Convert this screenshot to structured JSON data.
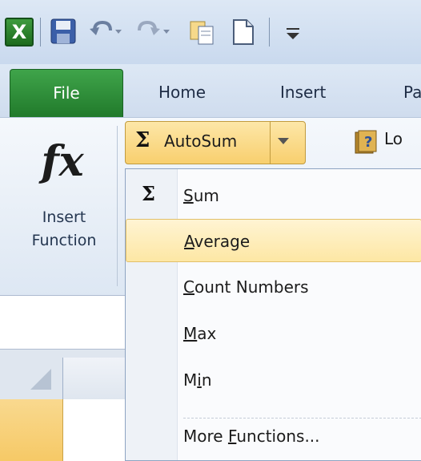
{
  "qat": {
    "app_icon": "excel-icon",
    "app_icon_letter": "X",
    "icons": [
      "save-icon",
      "undo-icon",
      "redo-icon",
      "copy-icon",
      "new-document-icon",
      "customize-qat-icon"
    ]
  },
  "tabs": {
    "file": "File",
    "home": "Home",
    "insert": "Insert",
    "partial": "Pa"
  },
  "ribbon": {
    "insert_function": {
      "glyph": "fx",
      "label": "Insert\nFunction"
    },
    "autosum": {
      "symbol": "Σ",
      "label": "AutoSum"
    },
    "logical": {
      "label": "Lo"
    }
  },
  "menu": {
    "items": [
      {
        "pre": "",
        "access": "S",
        "post": "um",
        "icon": "sigma"
      },
      {
        "pre": "",
        "access": "A",
        "post": "verage",
        "highlighted": true
      },
      {
        "pre": "",
        "access": "C",
        "post": "ount Numbers"
      },
      {
        "pre": "",
        "access": "M",
        "post": "ax"
      },
      {
        "pre": "M",
        "access": "i",
        "post": "n"
      },
      {
        "pre": "More ",
        "access": "F",
        "post": "unctions..."
      }
    ],
    "sigma": "Σ"
  },
  "colors": {
    "file_tab": "#2e8f38",
    "highlight": "#fde7a4",
    "ribbon_bg": "#dde7f3"
  }
}
